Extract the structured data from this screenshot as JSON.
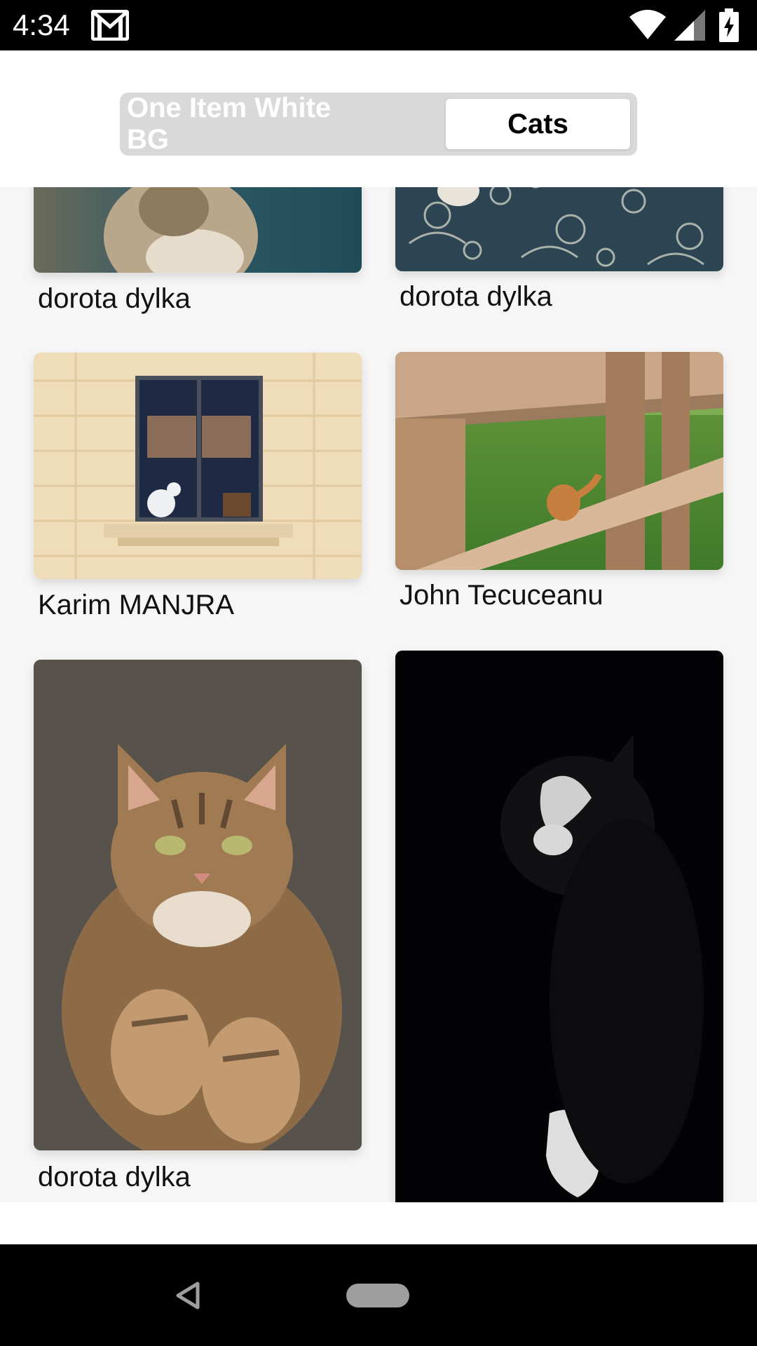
{
  "status_bar": {
    "time": "4:34",
    "icons": [
      "gmail-icon",
      "wifi-icon",
      "signal-icon",
      "battery-charging-icon"
    ]
  },
  "segmented_control": {
    "tabs": [
      {
        "label": "One Item White BG",
        "selected": false
      },
      {
        "label": "Cats",
        "selected": true
      }
    ]
  },
  "grid": {
    "cards": [
      {
        "caption": "dorota dylka",
        "image": "fluffy-cat-photo"
      },
      {
        "caption": "dorota dylka",
        "image": "cat-on-floral-blanket-photo"
      },
      {
        "caption": "Karim MANJRA",
        "image": "cat-in-window-photo"
      },
      {
        "caption": "John Tecuceanu",
        "image": "cat-behind-fence-photo"
      },
      {
        "caption": "dorota dylka",
        "image": "tabby-cat-lying-photo"
      },
      {
        "caption": "",
        "image": "black-white-cat-in-dark-photo"
      }
    ]
  },
  "nav_bar": {
    "icons": [
      "back-icon",
      "home-pill-icon"
    ]
  },
  "colors": {
    "status_bar": "#000000",
    "segment_bg": "#d9d9d9",
    "segment_active": "#ffffff",
    "page_bg": "#f6f6f6"
  }
}
